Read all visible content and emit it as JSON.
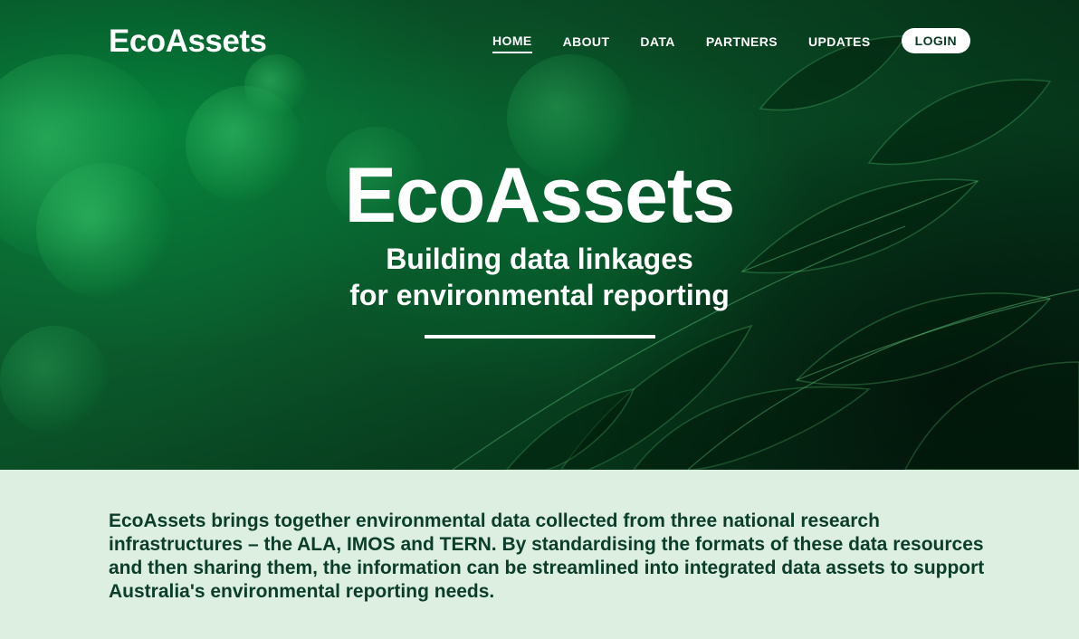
{
  "header": {
    "brand": "EcoAssets",
    "nav": [
      {
        "label": "HOME",
        "active": true
      },
      {
        "label": "ABOUT",
        "active": false
      },
      {
        "label": "DATA",
        "active": false
      },
      {
        "label": "PARTNERS",
        "active": false
      },
      {
        "label": "UPDATES",
        "active": false
      }
    ],
    "login_label": "LOGIN"
  },
  "hero": {
    "title": "EcoAssets",
    "subtitle_line1": "Building data linkages",
    "subtitle_line2": "for environmental reporting"
  },
  "intro": {
    "text": "EcoAssets brings together environmental data collected from three national research infrastructures – the ALA, IMOS and TERN. By standardising the formats of these data resources and then sharing them, the information can be streamlined into integrated data assets to support Australia's environmental reporting needs."
  },
  "colors": {
    "hero_green": "#0b5a2c",
    "intro_background": "#dcefe1",
    "intro_text": "#0b3d2a",
    "login_text": "#0b3a24"
  }
}
